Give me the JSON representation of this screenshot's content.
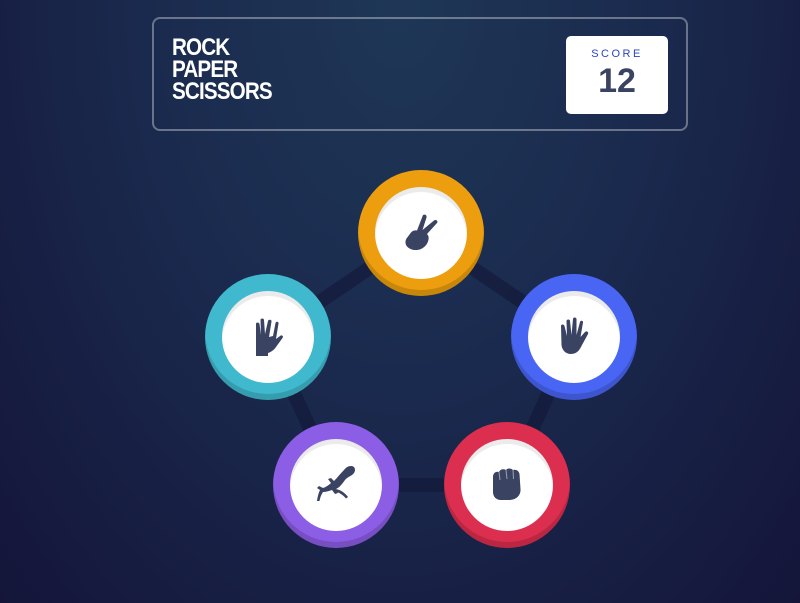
{
  "app": {
    "title_lines": [
      "ROCK",
      "PAPER",
      "SCISSORS"
    ]
  },
  "score": {
    "label": "SCORE",
    "value": "12"
  },
  "tokens": [
    {
      "id": "scissors",
      "icon": "scissors-hand-icon",
      "color": "#ec9e0e"
    },
    {
      "id": "paper",
      "icon": "paper-hand-icon",
      "color": "#4865f4"
    },
    {
      "id": "rock",
      "icon": "rock-fist-icon",
      "color": "#dc2e4e"
    },
    {
      "id": "lizard",
      "icon": "lizard-icon",
      "color": "#8c5de5"
    },
    {
      "id": "spock",
      "icon": "spock-hand-icon",
      "color": "#40b9ce"
    }
  ],
  "colors": {
    "background_top": "#1f3756",
    "background_bottom": "#141539",
    "icon": "#3b4363",
    "score_label": "#2a46c0"
  }
}
